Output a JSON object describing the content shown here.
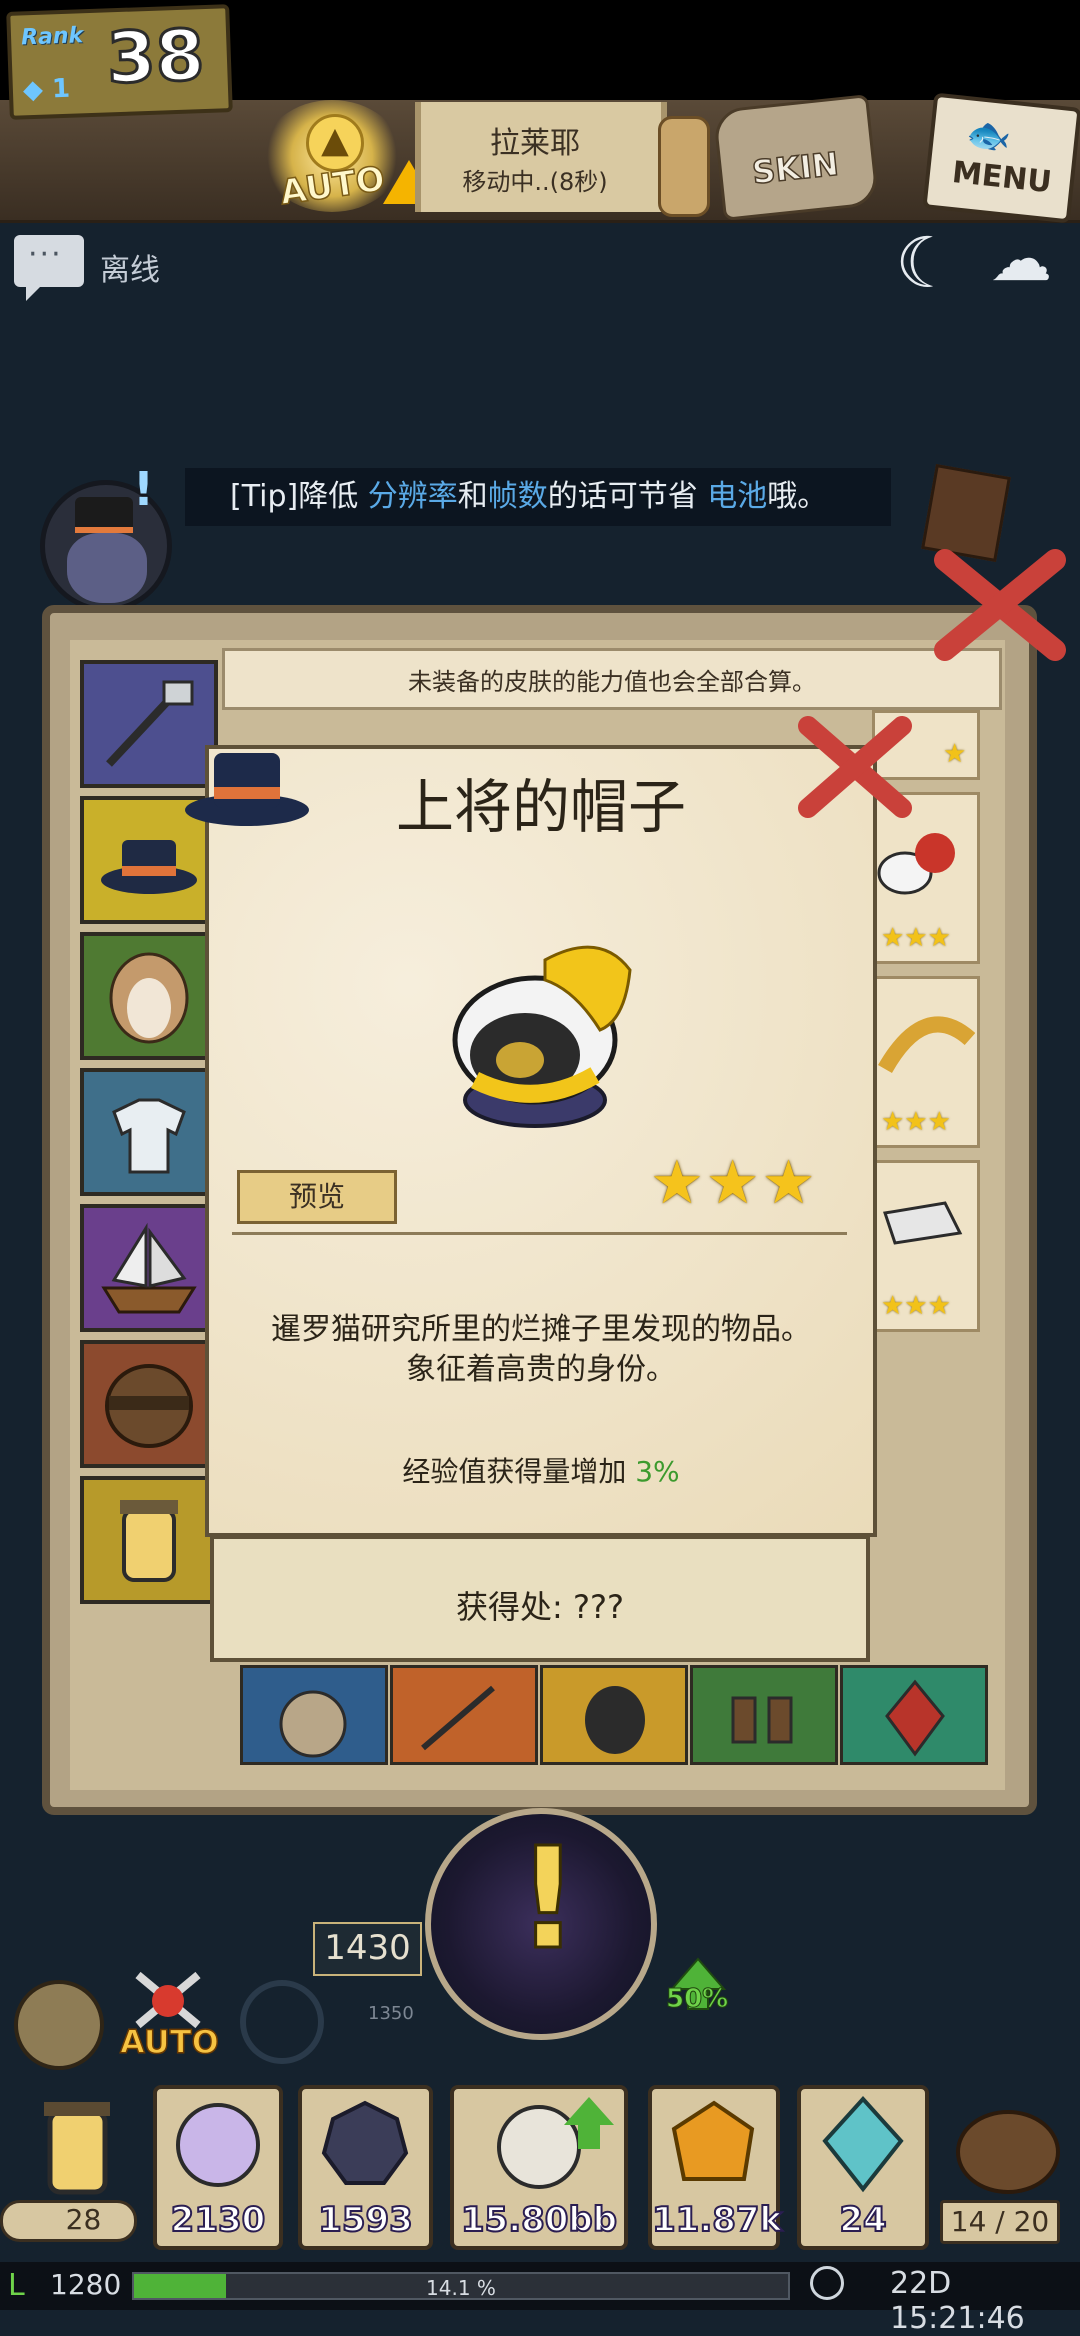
{
  "hud": {
    "rank_label": "Rank",
    "rank": "38",
    "gem_count": "1",
    "auto_label": "AUTO",
    "location": "拉莱耶",
    "location_status": "移动中..(8秒)",
    "skin_label": "SKIN",
    "menu_label": "MENU"
  },
  "chat": {
    "status": "离线"
  },
  "tip": {
    "prefix": "[Tip]降低 ",
    "kw1": "分辨率",
    "mid1": "和",
    "kw2": "帧数",
    "mid2": "的话可节省 ",
    "kw3": "电池",
    "suffix": "哦。"
  },
  "panel": {
    "info_text": "未装备的皮肤的能力值也会全部合算。"
  },
  "item": {
    "title": "上将的帽子",
    "preview_label": "预览",
    "stars": 3,
    "stars_text": "★★★",
    "description_line1": "暹罗猫研究所里的烂摊子里发现的物品。",
    "description_line2": "象征着高贵的身份。",
    "bonus_label": "经验值获得量增加 ",
    "bonus_value": "3%",
    "source_label": "获得处:  ???"
  },
  "right_slots": [
    {
      "stars_text": "★"
    },
    {
      "stars_text": "★★★"
    },
    {
      "stars_text": "★★★"
    },
    {
      "stars_text": "★★★"
    }
  ],
  "battle": {
    "power": "1430",
    "power_small": "1350",
    "boost": "50%",
    "auto_label": "AUTO"
  },
  "resources": {
    "lamp": "28",
    "orb": "2130",
    "gear": "1593",
    "shell": "15.80bb",
    "amber": "11.87k",
    "crystal": "24",
    "bag": "14 / 20"
  },
  "status": {
    "level": "1280",
    "exp_percent": 14.1,
    "exp_text": "14.1 %",
    "time": "22D 15:21:46"
  },
  "colors": {
    "accent_blue": "#5aa9e6",
    "bonus_green": "#3c9a2e",
    "star_gold": "#f5c31c"
  }
}
